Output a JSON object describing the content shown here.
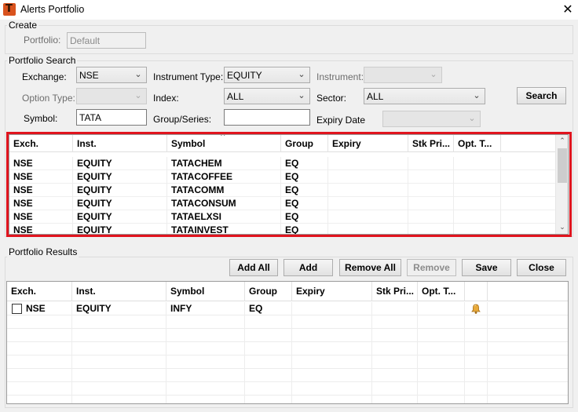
{
  "window": {
    "title": "Alerts Portfolio",
    "app_icon_letter": "T",
    "close_glyph": "✕"
  },
  "create": {
    "group_title": "Create",
    "portfolio_label": "Portfolio:",
    "portfolio_value": "Default"
  },
  "search": {
    "group_title": "Portfolio Search",
    "exchange_label": "Exchange:",
    "exchange_value": "NSE",
    "instrument_type_label": "Instrument Type:",
    "instrument_type_value": "EQUITY",
    "instrument_label": "Instrument:",
    "instrument_value": "",
    "option_type_label": "Option Type:",
    "option_type_value": "",
    "index_label": "Index:",
    "index_value": "ALL",
    "sector_label": "Sector:",
    "sector_value": "ALL",
    "search_button": "Search",
    "symbol_label": "Symbol:",
    "symbol_value": "TATA",
    "group_series_label": "Group/Series:",
    "group_series_value": "",
    "expiry_date_label": "Expiry Date",
    "expiry_date_value": "",
    "dropdown_glyph": "⌄"
  },
  "search_grid": {
    "columns": [
      "Exch.",
      "Inst.",
      "Symbol",
      "Group",
      "Expiry",
      "Stk Pri...",
      "Opt. T..."
    ],
    "sort_glyph": "^",
    "rows": [
      [
        "NSE",
        "EQUITY",
        "TATACHEM",
        "EQ",
        "",
        "",
        ""
      ],
      [
        "NSE",
        "EQUITY",
        "TATACOFFEE",
        "EQ",
        "",
        "",
        ""
      ],
      [
        "NSE",
        "EQUITY",
        "TATACOMM",
        "EQ",
        "",
        "",
        ""
      ],
      [
        "NSE",
        "EQUITY",
        "TATACONSUM",
        "EQ",
        "",
        "",
        ""
      ],
      [
        "NSE",
        "EQUITY",
        "TATAELXSI",
        "EQ",
        "",
        "",
        ""
      ],
      [
        "NSE",
        "EQUITY",
        "TATAINVEST",
        "EQ",
        "",
        "",
        ""
      ]
    ],
    "scroll_up_glyph": "⌃",
    "scroll_down_glyph": "⌄"
  },
  "results": {
    "group_title": "Portfolio Results",
    "buttons": {
      "add_all": "Add All",
      "add": "Add",
      "remove_all": "Remove All",
      "remove": "Remove",
      "save": "Save",
      "close": "Close"
    }
  },
  "results_grid": {
    "columns": [
      "Exch.",
      "Inst.",
      "Symbol",
      "Group",
      "Expiry",
      "Stk Pri...",
      "Opt. T..."
    ],
    "rows": [
      [
        "NSE",
        "EQUITY",
        "INFY",
        "EQ",
        "",
        "",
        ""
      ]
    ],
    "alert_icon": "bell-icon"
  },
  "colors": {
    "highlight_frame": "#e0141e",
    "window_bg": "#f0f0f0"
  }
}
